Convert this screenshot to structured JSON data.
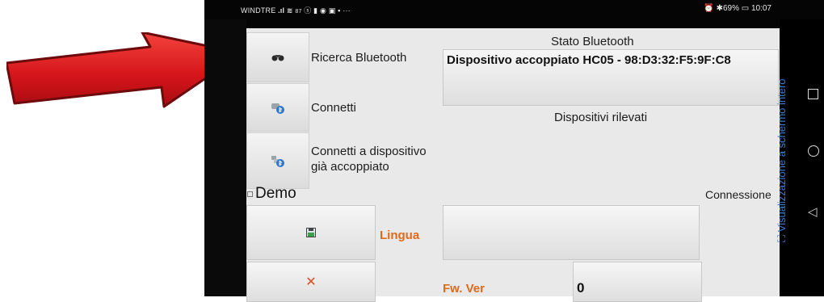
{
  "statusbar": {
    "carrier": "WINDTRE",
    "speed": "87\nB/s",
    "right": "⏰ ✱69% ▭ 10:07"
  },
  "left_panel": {
    "search_bt_label": "Ricerca Bluetooth",
    "connect_label": "Connetti",
    "connect_paired_line1": "Connetti a dispositivo",
    "connect_paired_line2": "già accoppiato",
    "demo_label": "Demo"
  },
  "right_panel": {
    "state_title": "Stato Bluetooth",
    "state_value": "Dispositivo accoppiato HC05 - 98:D3:32:F5:9F:C8",
    "detected_title": "Dispositivi rilevati",
    "connection_label": "Connessione"
  },
  "bottom": {
    "language_label": "Lingua",
    "fw_label": "Fw. Ver",
    "fw_value": "0"
  },
  "fullscreen_hint": "Visualizzazione a schermo intero",
  "icons": [
    "binoculars-icon",
    "bluetooth-connect-icon",
    "bluetooth-paired-icon",
    "save-icon",
    "close-x-icon"
  ],
  "colors": {
    "accent_orange": "#e06a17",
    "hint_blue": "#3c7bd8",
    "arrow_red": "#d0141a"
  }
}
